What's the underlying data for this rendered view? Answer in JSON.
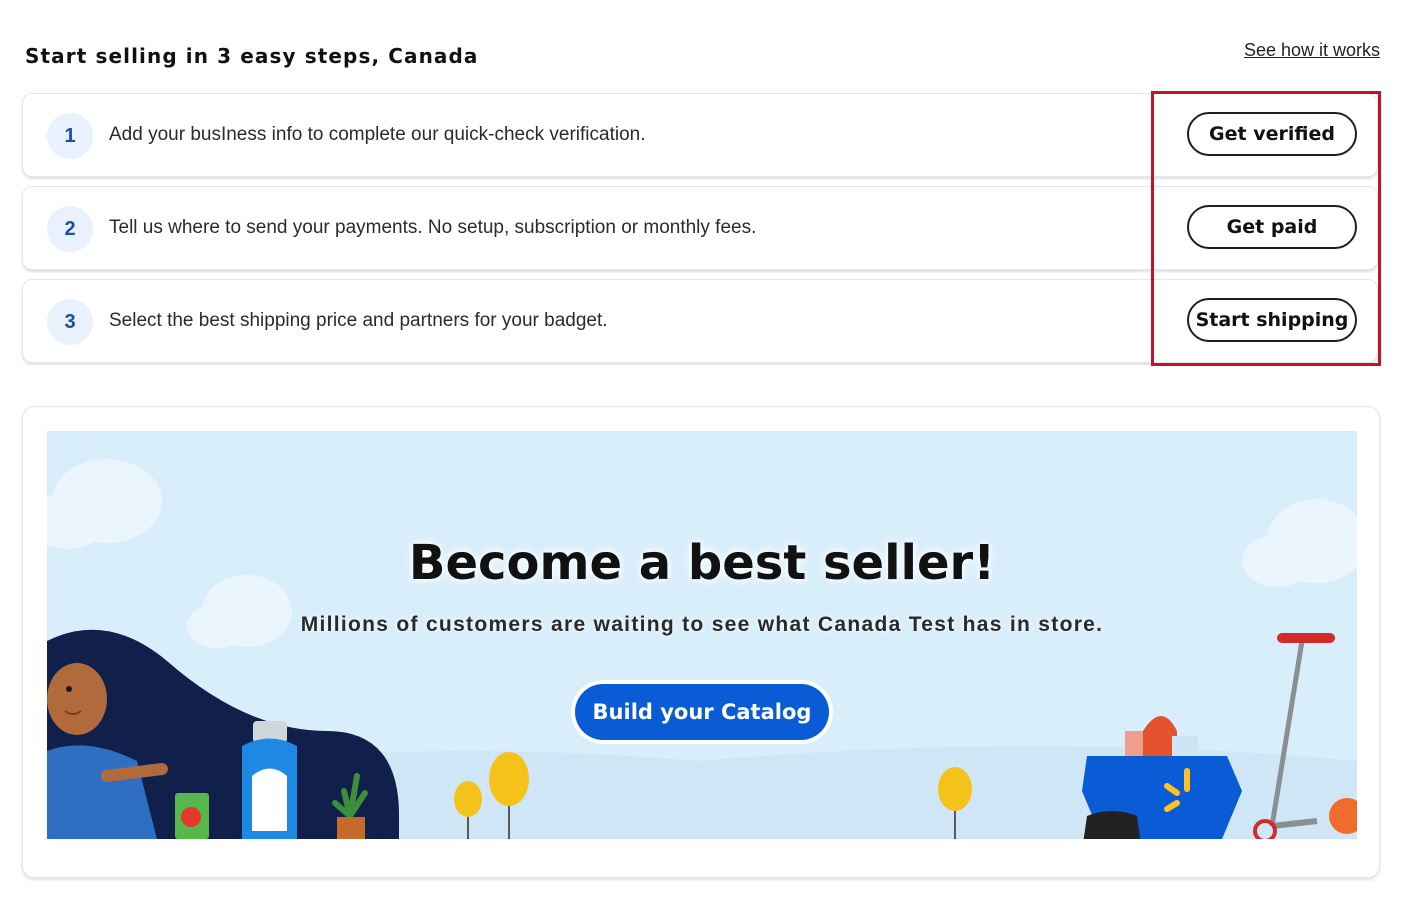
{
  "header": {
    "title": "Start selling in 3 easy steps, Canada",
    "see_how_link": "See how it works"
  },
  "steps": [
    {
      "number": "1",
      "text": "Add your busIness info to complete our quick-check verification.",
      "button": "Get verified"
    },
    {
      "number": "2",
      "text": "Tell us where to send your payments. No setup, subscription or monthly fees.",
      "button": "Get paid"
    },
    {
      "number": "3",
      "text": "Select the best shipping price and partners for your badget.",
      "button": "Start shipping"
    }
  ],
  "promo": {
    "title": "Become a best seller!",
    "subtitle": "Millions of customers are waiting to see what Canada Test has in store.",
    "cta_label": "Build your Catalog"
  },
  "colors": {
    "accent": "#0a5cd6",
    "highlight": "#c0142c",
    "banner_bg": "#d9eefb",
    "step_badge_bg": "#e8f1fc"
  }
}
